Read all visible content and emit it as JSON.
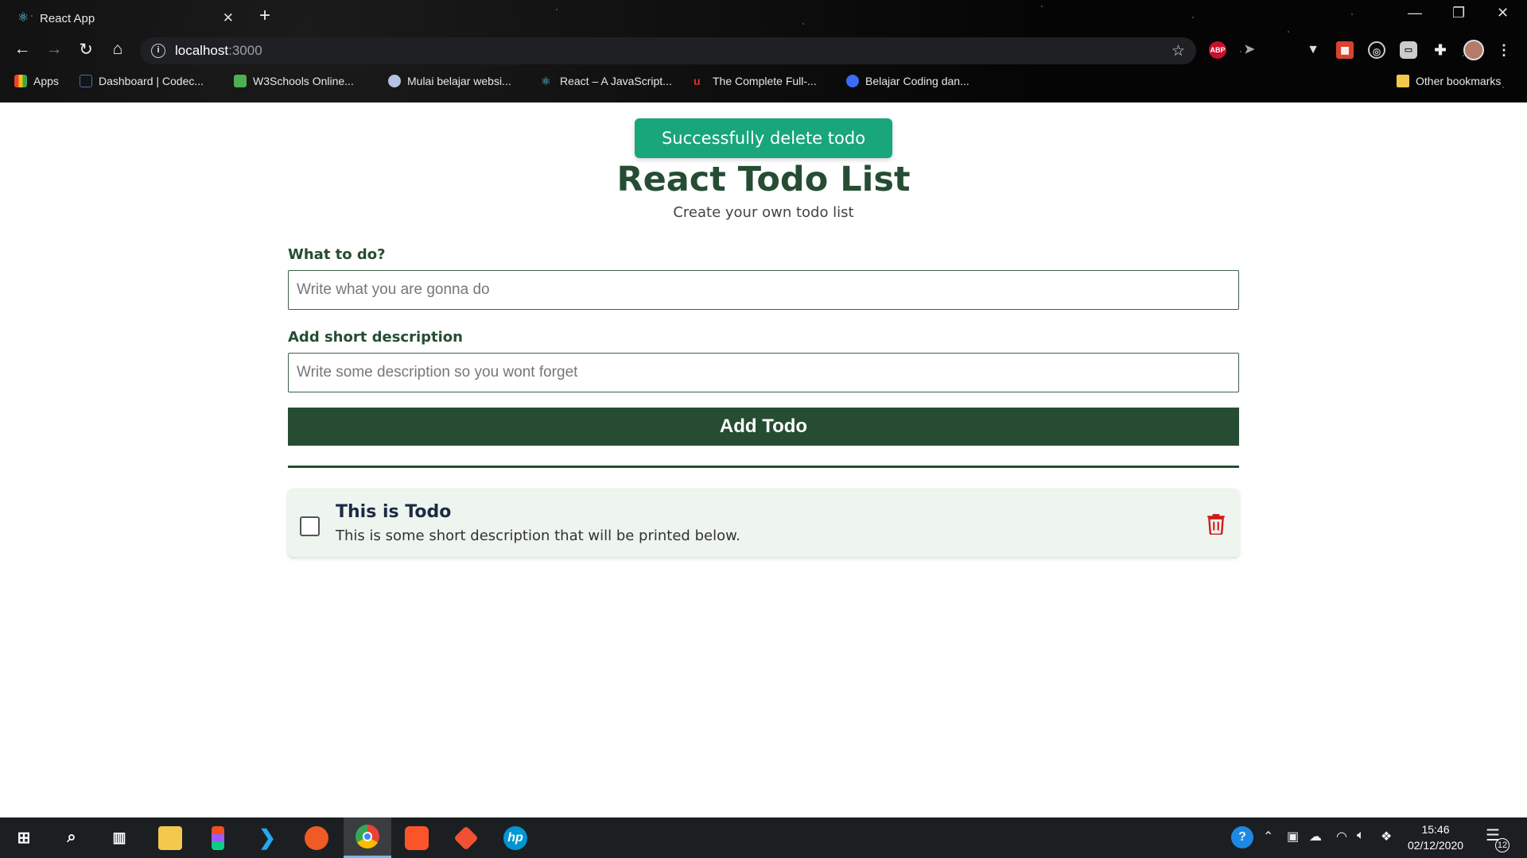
{
  "browser": {
    "tab_title": "React App",
    "tab_close": "✕",
    "new_tab": "+",
    "url_host": "localhost",
    "url_port": ":3000",
    "extensions": [
      "ABP"
    ],
    "bookmarks": [
      {
        "label": "Apps",
        "color": "#e94235"
      },
      {
        "label": "Dashboard | Codec...",
        "color": "#4a6fa5"
      },
      {
        "label": "W3Schools Online...",
        "color": "#4caf50"
      },
      {
        "label": "Mulai belajar websi...",
        "color": "#b3c3e6"
      },
      {
        "label": "React – A JavaScript...",
        "color": "#61dafb"
      },
      {
        "label": "The Complete Full-...",
        "color": "#e0312e"
      },
      {
        "label": "Belajar Coding dan...",
        "color": "#3b6cf6"
      }
    ],
    "other_bookmarks": "Other bookmarks"
  },
  "page": {
    "toast": "Successfully delete todo",
    "title": "React Todo List",
    "subtitle": "Create your own todo list",
    "todo_label": "What to do?",
    "todo_placeholder": "Write what you are gonna do",
    "desc_label": "Add short description",
    "desc_placeholder": "Write some description so you wont forget",
    "add_button": "Add Todo",
    "todos": [
      {
        "title": "This is Todo",
        "description": "This is some short description that will be printed below.",
        "done": false
      }
    ]
  },
  "taskbar": {
    "time": "15:46",
    "date": "02/12/2020",
    "notifications": "12"
  },
  "colors": {
    "primary": "#264d33",
    "toast": "#18a67a",
    "danger": "#d11a1a",
    "card": "#eef4ee"
  }
}
